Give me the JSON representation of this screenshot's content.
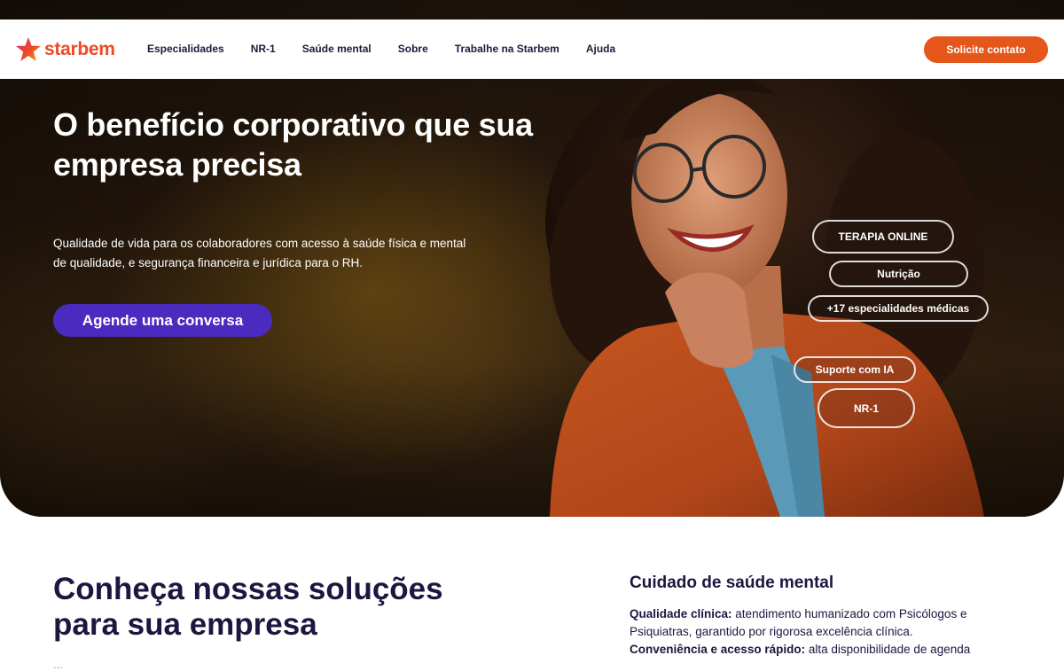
{
  "brand": {
    "name": "starbem",
    "color": "#ef4a23"
  },
  "nav": {
    "links": [
      "Especialidades",
      "NR-1",
      "Saúde mental",
      "Sobre",
      "Trabalhe na Starbem",
      "Ajuda"
    ],
    "cta_label": "Solicite contato"
  },
  "hero": {
    "title": "O benefício corporativo que sua empresa precisa",
    "subtitle": "Qualidade de vida para os colaboradores com acesso à saúde física e mental de qualidade, e segurança financeira e jurídica para o RH.",
    "cta_label": "Agende uma conversa",
    "pills": [
      "TERAPIA ONLINE",
      "Nutrição",
      "+17 especialidades médicas",
      "Suporte com IA",
      "NR-1"
    ]
  },
  "solutions": {
    "title": "Conheça nossas soluções para sua empresa",
    "faded_line": "...",
    "care": {
      "title": "Cuidado de saúde mental",
      "item1_label": "Qualidade clínica:",
      "item1_text": " atendimento humanizado com Psicólogos e Psiquiatras, garantido por rigorosa excelência clínica.",
      "item2_label": "Conveniência e acesso rápido:",
      "item2_text": " alta disponibilidade de agenda"
    }
  },
  "colors": {
    "accent_orange": "#e4561a",
    "accent_purple": "#4b2ac0",
    "navy": "#1a1740"
  }
}
